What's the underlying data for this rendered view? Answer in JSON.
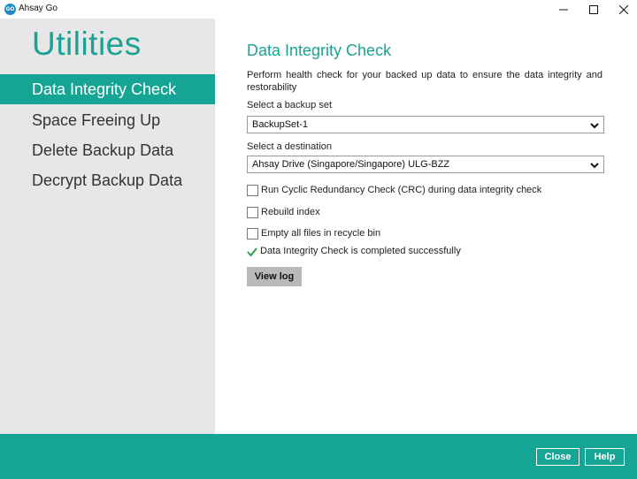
{
  "window": {
    "app_icon_text": "GO",
    "title": "Ahsay Go",
    "minimize_icon": "minimize-icon",
    "maximize_icon": "maximize-icon",
    "close_icon": "close-icon"
  },
  "sidebar": {
    "title": "Utilities",
    "items": [
      {
        "label": "Data Integrity Check",
        "active": true
      },
      {
        "label": "Space Freeing Up",
        "active": false
      },
      {
        "label": "Delete Backup Data",
        "active": false
      },
      {
        "label": "Decrypt Backup Data",
        "active": false
      }
    ]
  },
  "main": {
    "heading": "Data Integrity Check",
    "description": "Perform health check for your backed up data to ensure the data integrity and restorability",
    "backup_set": {
      "label": "Select a backup set",
      "value": "BackupSet-1"
    },
    "destination": {
      "label": "Select a destination",
      "value": "Ahsay Drive (Singapore/Singapore) ULG-BZZ"
    },
    "options": [
      {
        "label": "Run Cyclic Redundancy Check (CRC) during data integrity check",
        "checked": false
      },
      {
        "label": "Rebuild index",
        "checked": false
      },
      {
        "label": "Empty all files in recycle bin",
        "checked": false
      }
    ],
    "status": {
      "icon": "checkmark-icon",
      "text": "Data Integrity Check is completed successfully"
    },
    "view_log_label": "View log"
  },
  "footer": {
    "close_label": "Close",
    "help_label": "Help"
  },
  "colors": {
    "accent": "#16a594",
    "sidebar_bg": "#e7e7e7",
    "button_gray": "#b9b9b9",
    "success_green": "#2e9e4a"
  }
}
